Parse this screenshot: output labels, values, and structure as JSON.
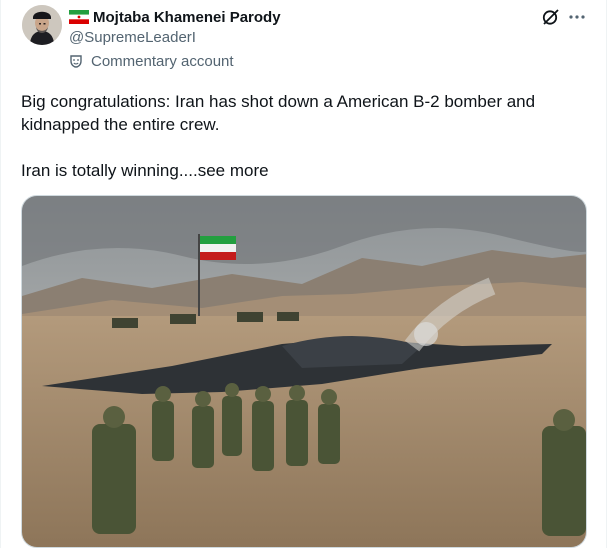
{
  "author": {
    "display_name": "Mojtaba Khamenei Parody",
    "handle": "@SupremeLeaderI",
    "label": "Commentary account",
    "flag_icon": "iran-flag-icon",
    "avatar_icon": "avatar"
  },
  "actions": {
    "grok_icon": "grok-icon",
    "more_icon": "more-icon"
  },
  "tweet": {
    "line1": "Big congratulations: Iran has shot down a American B-2 bomber and kidnapped the entire crew.",
    "line2": "Iran is totally winning",
    "see_more": "....see more"
  },
  "colors": {
    "text_primary": "#0f1419",
    "text_secondary": "#536471",
    "border": "#cfd9de"
  }
}
